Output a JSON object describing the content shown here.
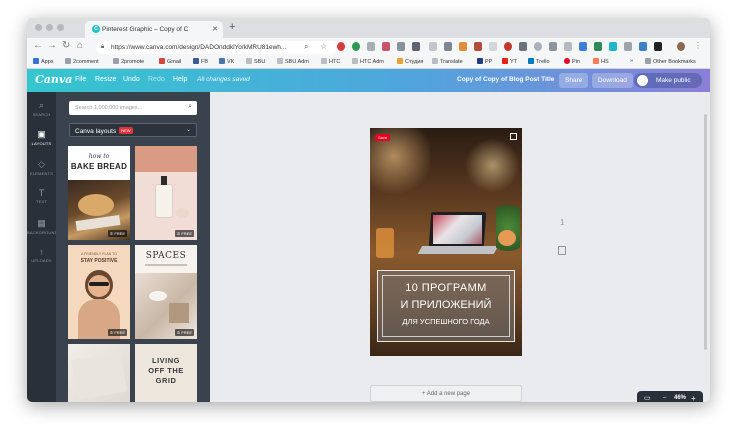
{
  "browser": {
    "tab_title": "Pinterest Graphic – Copy of C",
    "tab_favicon": "C",
    "url": "https://www.canva.com/design/DADOnddklYo/kMRU81ewh...",
    "new_tab": "+",
    "bookmarks": [
      "Apps",
      "2comment",
      "2promote",
      "Gmail",
      "FB",
      "VK",
      "SBU",
      "SBU Adm",
      "HTC",
      "HTC Adm",
      "Студия",
      "Translate",
      "PP",
      "YT",
      "Trello",
      "Pin",
      "HS",
      "»",
      "Other Bookmarks"
    ]
  },
  "canva": {
    "logo": "Canva",
    "menu": [
      "File",
      "Resize",
      "Undo",
      "Redo",
      "Help"
    ],
    "status": "All changes saved",
    "doc_title": "Copy of Copy of Blog Post Title",
    "share": "Share",
    "download": "Download",
    "make_public": "Make public"
  },
  "rail": [
    {
      "label": "SEARCH",
      "icon": "⌕"
    },
    {
      "label": "LAYOUTS",
      "icon": "▣"
    },
    {
      "label": "ELEMENTS",
      "icon": "◇"
    },
    {
      "label": "TEXT",
      "icon": "T"
    },
    {
      "label": "BACKGROUND",
      "icon": "▦"
    },
    {
      "label": "UPLOADS",
      "icon": "↑"
    }
  ],
  "panel": {
    "search_placeholder": "Search 1,000,000 images...",
    "layouts_label": "Canva layouts",
    "new_badge": "NEW",
    "free_badge": "♔ FREE",
    "thumbs": [
      {
        "line1": "how to",
        "line2": "BAKE BREAD"
      },
      {
        "line1": "",
        "line2": ""
      },
      {
        "line1": "A FRIENDLY PLAN TO",
        "line2": "STAY POSITIVE"
      },
      {
        "line1": "SPACES",
        "line2": ""
      },
      {
        "line1": "",
        "line2": ""
      },
      {
        "line1": "LIVING",
        "line2": "OFF THE",
        "line3": "GRID"
      }
    ]
  },
  "design": {
    "save_pin": "Save",
    "title_line1": "10 ПРОГРАММ",
    "title_line2": "И ПРИЛОЖЕНИЙ",
    "title_line3": "ДЛЯ УСПЕШНОГО ГОДА"
  },
  "workspace": {
    "page_number": "1",
    "add_page": "+ Add a new page",
    "zoom_value": "46%",
    "zoom_minus": "–",
    "zoom_plus": "+"
  },
  "colors": {
    "canva_gradient_start": "#34c6cf",
    "canva_gradient_end": "#8a7fd8",
    "rail_bg": "#293039",
    "panel_bg": "#3a424d"
  }
}
